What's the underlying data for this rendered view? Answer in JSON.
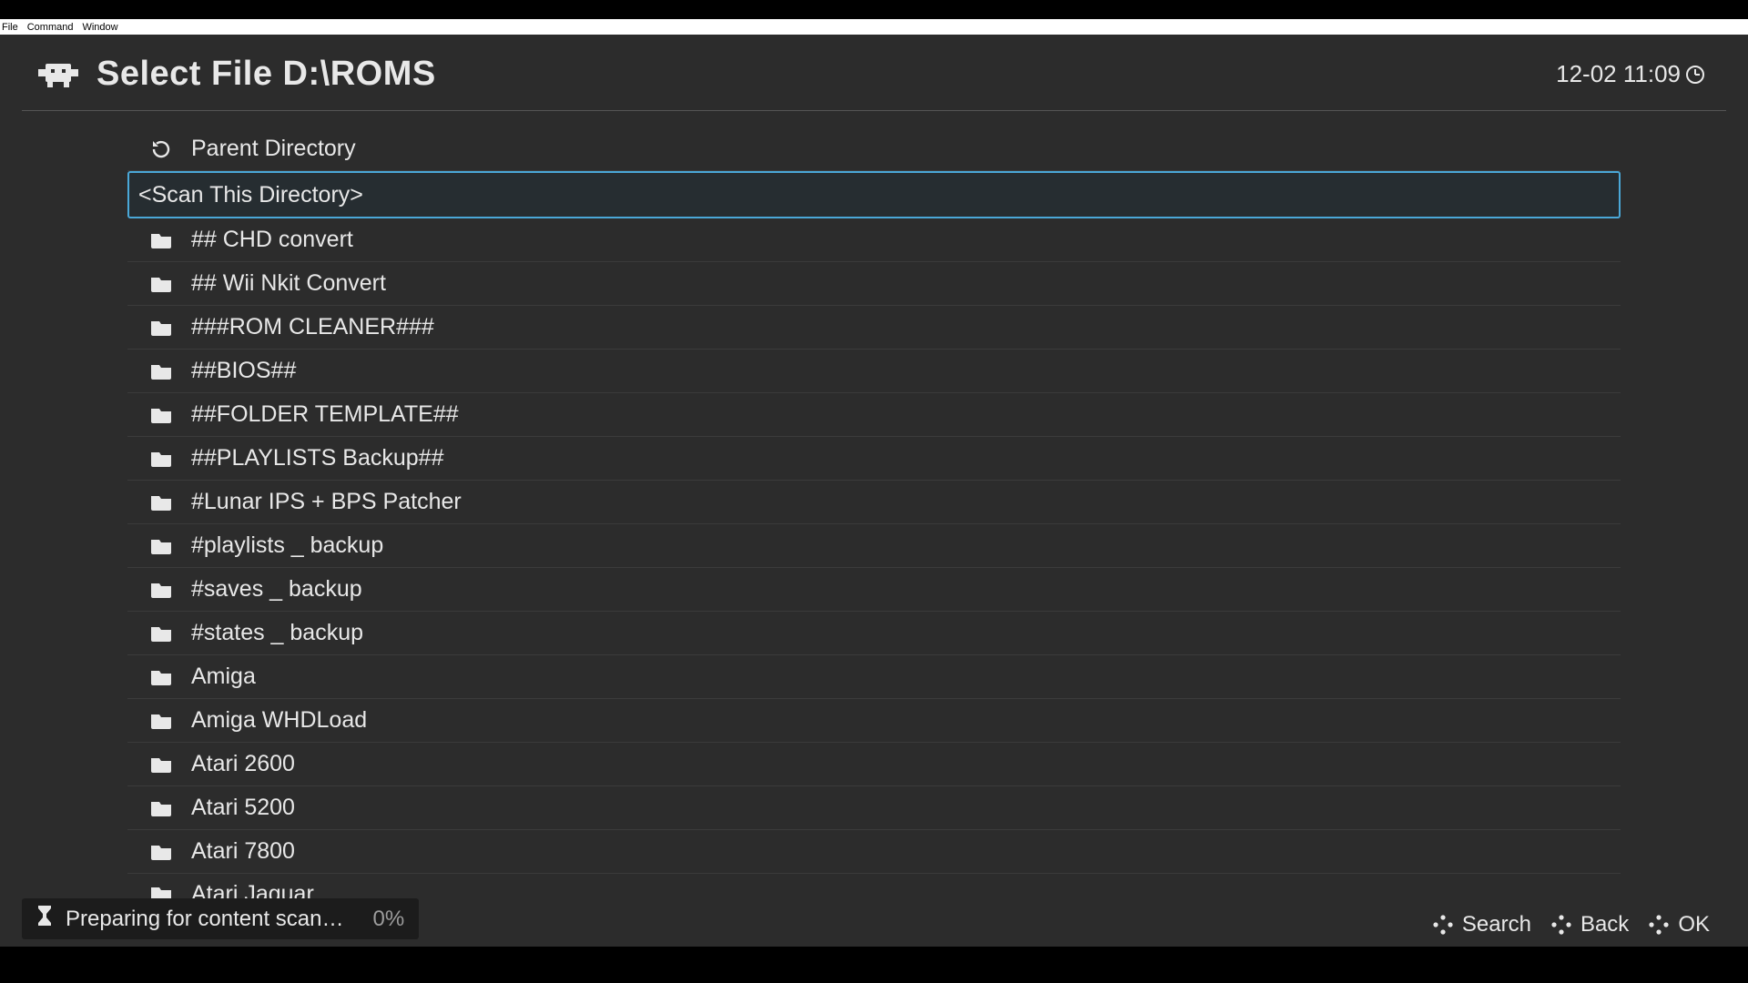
{
  "menubar": {
    "items": [
      "File",
      "Command",
      "Window"
    ]
  },
  "header": {
    "title": "Select File D:\\ROMS",
    "time": "12-02 11:09"
  },
  "list": {
    "parent": "Parent Directory",
    "scan": "<Scan This Directory>",
    "items": [
      "## CHD convert",
      "## Wii Nkit Convert",
      "###ROM CLEANER###",
      "##BIOS##",
      "##FOLDER TEMPLATE##",
      "##PLAYLISTS Backup##",
      "#Lunar IPS + BPS Patcher",
      "#playlists _ backup",
      "#saves _ backup",
      "#states _ backup",
      "Amiga",
      "Amiga WHDLoad",
      "Atari 2600",
      "Atari 5200",
      "Atari 7800",
      "Atari Jaguar"
    ]
  },
  "status": {
    "text": "Preparing for content scan…",
    "percent": "0%"
  },
  "footer": {
    "search": "Search",
    "back": "Back",
    "ok": "OK"
  }
}
